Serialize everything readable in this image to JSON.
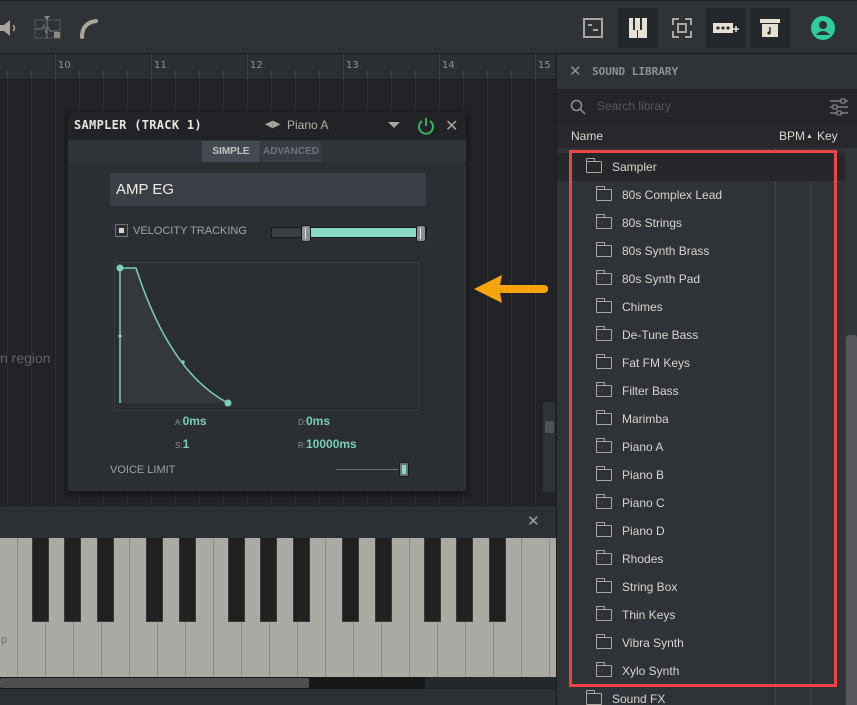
{
  "toolbar": {
    "left_icons": [
      "speaker-icon",
      "waveform-lock-icon",
      "curve-icon"
    ],
    "right_icons": [
      "mixer-icon",
      "piano-keys-icon",
      "focus-icon",
      "add-device-icon",
      "sound-library-icon",
      "account-icon"
    ],
    "accent": "#2ecc9a"
  },
  "ruler": {
    "bars": [
      "10",
      "11",
      "12",
      "13",
      "14",
      "15"
    ]
  },
  "tracks": {
    "hint_text": "n region"
  },
  "sampler": {
    "title": "SAMPLER (TRACK 1)",
    "preset": "Piano A",
    "tabs": [
      {
        "label": "SIMPLE",
        "active": true
      },
      {
        "label": "ADVANCED",
        "active": false
      }
    ],
    "section_title": "AMP EG",
    "velocity_tracking": {
      "label": "VELOCITY TRACKING",
      "checked": true,
      "range_low": 0.22,
      "range_high": 1.0
    },
    "envelope": {
      "attack_label": "A:",
      "attack": "0ms",
      "decay_label": "D:",
      "decay": "0ms",
      "sustain_label": "S:",
      "sustain": "1",
      "release_label": "R:",
      "release": "10000ms"
    },
    "voice_limit": {
      "label": "VOICE LIMIT",
      "value_fraction": 1.0
    },
    "accent": "#86d9c4"
  },
  "piano": {
    "label_fragment": "p"
  },
  "library": {
    "title": "SOUND LIBRARY",
    "search_placeholder": "Search library",
    "columns": {
      "name": "Name",
      "bpm": "BPM",
      "key": "Key",
      "sort_indicator": "▲"
    },
    "root_folder": "Sampler",
    "items": [
      "80s Complex Lead",
      "80s Strings",
      "80s Synth Brass",
      "80s Synth Pad",
      "Chimes",
      "De-Tune Bass",
      "Fat FM Keys",
      "Filter Bass",
      "Marimba",
      "Piano A",
      "Piano B",
      "Piano C",
      "Piano D",
      "Rhodes",
      "String Box",
      "Thin Keys",
      "Vibra Synth",
      "Xylo Synth"
    ],
    "next_root_folder": "Sound FX",
    "highlight_color": "#ef4444"
  },
  "annotation": {
    "arrow_color": "#f5a50a",
    "direction": "left"
  }
}
